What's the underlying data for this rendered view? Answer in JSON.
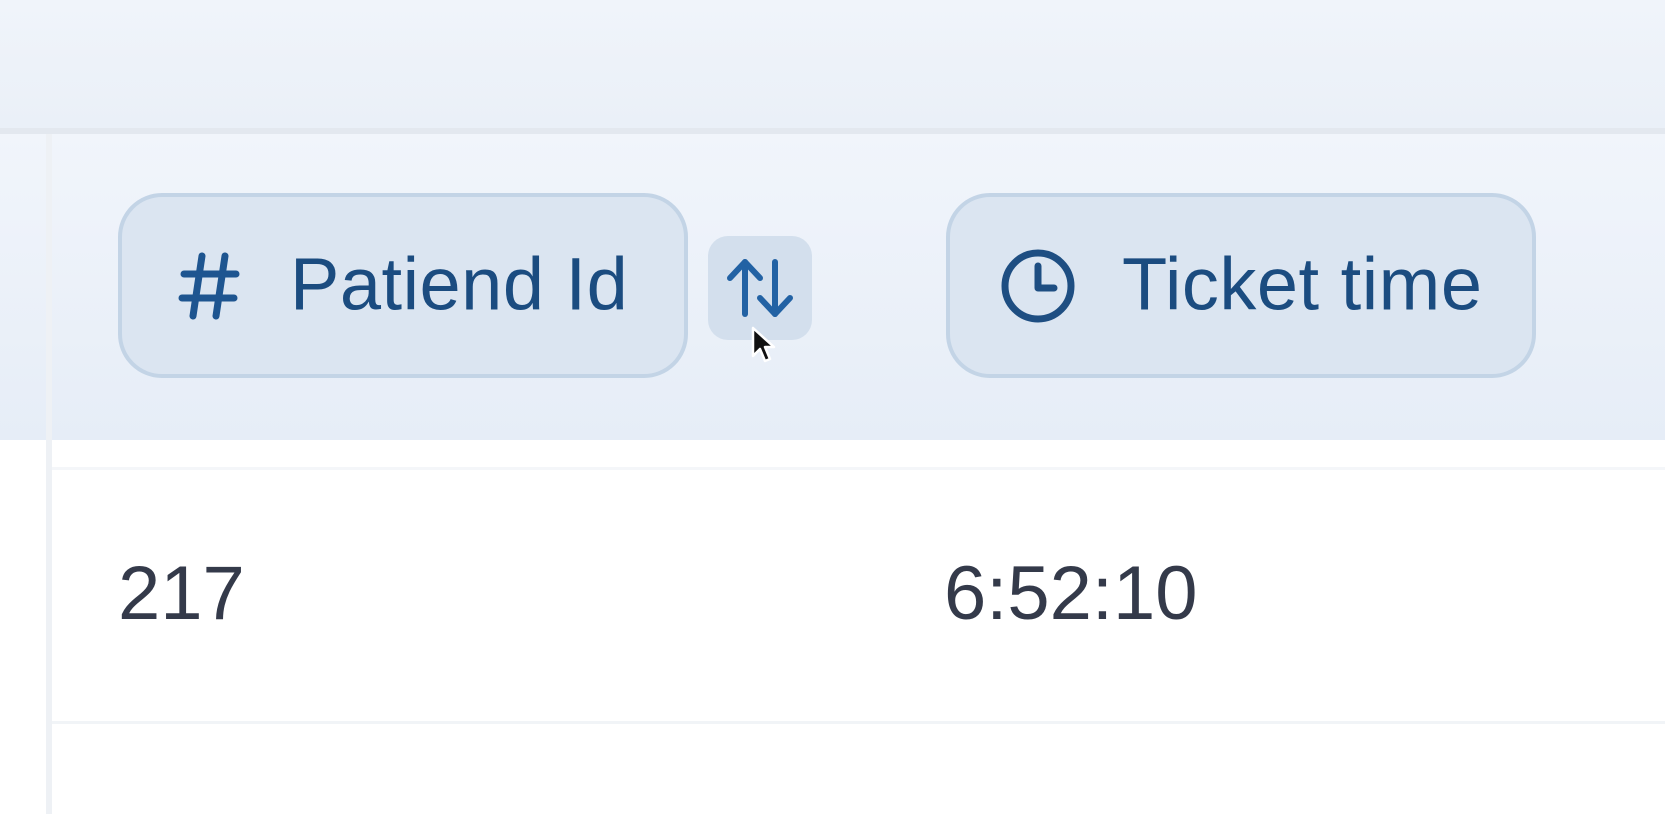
{
  "table": {
    "columns": [
      {
        "label": "Patiend Id",
        "icon": "hash-icon"
      },
      {
        "label": "Ticket time",
        "icon": "clock-icon"
      }
    ],
    "sort_icon": "sort-arrows-icon",
    "rows": [
      {
        "patient_id": "217",
        "ticket_time": "6:52:10"
      }
    ]
  },
  "colors": {
    "header_pill_bg": "#dbe5f1",
    "header_pill_border": "#c3d4e6",
    "header_text": "#1b4c80",
    "cell_text": "#343a4a"
  }
}
